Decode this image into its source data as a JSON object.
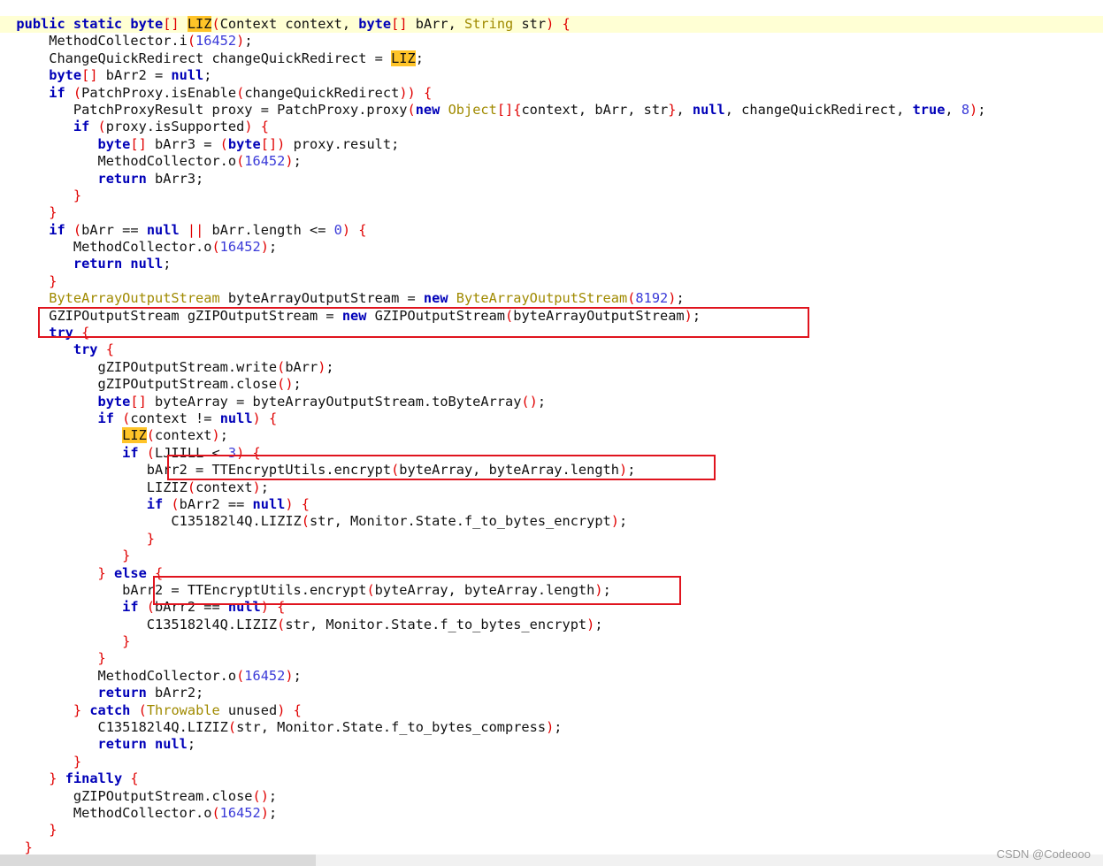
{
  "colors": {
    "plain": "#111111",
    "keyword": "#0000b8",
    "type": "#a08a00",
    "number": "#3a3ad8",
    "bracket": "#e00000",
    "highlight": "#ffc428",
    "annotation_box": "#e0141e"
  },
  "code": {
    "lines": [
      {
        "indent": "  ",
        "hl": true,
        "tokens": [
          [
            "public static ",
            "k"
          ],
          [
            "byte",
            "k"
          ],
          [
            "[]",
            "b"
          ],
          [
            " ",
            "p"
          ],
          [
            "LIZ",
            "h"
          ],
          [
            "(",
            "b"
          ],
          [
            "Context context, ",
            "p"
          ],
          [
            "byte",
            "k"
          ],
          [
            "[]",
            "b"
          ],
          [
            " bArr, ",
            "p"
          ],
          [
            "String",
            "t"
          ],
          [
            " str",
            "p"
          ],
          [
            ")",
            "b"
          ],
          [
            " {",
            "b"
          ]
        ]
      },
      {
        "indent": "      ",
        "tokens": [
          [
            "MethodCollector.i",
            "p"
          ],
          [
            "(",
            "b"
          ],
          [
            "16452",
            "n"
          ],
          [
            ")",
            "b"
          ],
          [
            ";",
            "p"
          ]
        ]
      },
      {
        "indent": "      ",
        "tokens": [
          [
            "ChangeQuickRedirect changeQuickRedirect = ",
            "p"
          ],
          [
            "LIZ",
            "h"
          ],
          [
            ";",
            "p"
          ]
        ]
      },
      {
        "indent": "      ",
        "tokens": [
          [
            "byte",
            "k"
          ],
          [
            "[]",
            "b"
          ],
          [
            " bArr2 = ",
            "p"
          ],
          [
            "null",
            "k"
          ],
          [
            ";",
            "p"
          ]
        ]
      },
      {
        "indent": "      ",
        "tokens": [
          [
            "if",
            "k"
          ],
          [
            " ",
            "p"
          ],
          [
            "(",
            "b"
          ],
          [
            "PatchProxy.isEnable",
            "p"
          ],
          [
            "(",
            "b"
          ],
          [
            "changeQuickRedirect",
            "p"
          ],
          [
            ")",
            "b"
          ],
          [
            ")",
            "b"
          ],
          [
            " {",
            "b"
          ]
        ]
      },
      {
        "indent": "         ",
        "tokens": [
          [
            "PatchProxyResult proxy = PatchProxy.proxy",
            "p"
          ],
          [
            "(",
            "b"
          ],
          [
            "new",
            "k"
          ],
          [
            " ",
            "p"
          ],
          [
            "Object",
            "t"
          ],
          [
            "[]{",
            "b"
          ],
          [
            "context, bArr, str",
            "p"
          ],
          [
            "}",
            "b"
          ],
          [
            ", ",
            "p"
          ],
          [
            "null",
            "k"
          ],
          [
            ", changeQuickRedirect, ",
            "p"
          ],
          [
            "true",
            "k"
          ],
          [
            ", ",
            "p"
          ],
          [
            "8",
            "n"
          ],
          [
            ")",
            "b"
          ],
          [
            ";",
            "p"
          ]
        ]
      },
      {
        "indent": "         ",
        "tokens": [
          [
            "if",
            "k"
          ],
          [
            " ",
            "p"
          ],
          [
            "(",
            "b"
          ],
          [
            "proxy.isSupported",
            "p"
          ],
          [
            ")",
            "b"
          ],
          [
            " {",
            "b"
          ]
        ]
      },
      {
        "indent": "            ",
        "tokens": [
          [
            "byte",
            "k"
          ],
          [
            "[]",
            "b"
          ],
          [
            " bArr3 = ",
            "p"
          ],
          [
            "(",
            "b"
          ],
          [
            "byte",
            "k"
          ],
          [
            "[])",
            "b"
          ],
          [
            " proxy.result;",
            "p"
          ]
        ]
      },
      {
        "indent": "            ",
        "tokens": [
          [
            "MethodCollector.o",
            "p"
          ],
          [
            "(",
            "b"
          ],
          [
            "16452",
            "n"
          ],
          [
            ")",
            "b"
          ],
          [
            ";",
            "p"
          ]
        ]
      },
      {
        "indent": "            ",
        "tokens": [
          [
            "return",
            "k"
          ],
          [
            " bArr3;",
            "p"
          ]
        ]
      },
      {
        "indent": "         ",
        "tokens": [
          [
            "}",
            "b"
          ]
        ]
      },
      {
        "indent": "      ",
        "tokens": [
          [
            "}",
            "b"
          ]
        ]
      },
      {
        "indent": "      ",
        "tokens": [
          [
            "if",
            "k"
          ],
          [
            " ",
            "p"
          ],
          [
            "(",
            "b"
          ],
          [
            "bArr == ",
            "p"
          ],
          [
            "null",
            "k"
          ],
          [
            " ",
            "p"
          ],
          [
            "||",
            "b"
          ],
          [
            " bArr.length <= ",
            "p"
          ],
          [
            "0",
            "n"
          ],
          [
            ")",
            "b"
          ],
          [
            " {",
            "b"
          ]
        ]
      },
      {
        "indent": "         ",
        "tokens": [
          [
            "MethodCollector.o",
            "p"
          ],
          [
            "(",
            "b"
          ],
          [
            "16452",
            "n"
          ],
          [
            ")",
            "b"
          ],
          [
            ";",
            "p"
          ]
        ]
      },
      {
        "indent": "         ",
        "tokens": [
          [
            "return",
            "k"
          ],
          [
            " ",
            "p"
          ],
          [
            "null",
            "k"
          ],
          [
            ";",
            "p"
          ]
        ]
      },
      {
        "indent": "      ",
        "tokens": [
          [
            "}",
            "b"
          ]
        ]
      },
      {
        "indent": "      ",
        "tokens": [
          [
            "ByteArrayOutputStream",
            "t"
          ],
          [
            " byteArrayOutputStream = ",
            "p"
          ],
          [
            "new",
            "k"
          ],
          [
            " ",
            "p"
          ],
          [
            "ByteArrayOutputStream",
            "t"
          ],
          [
            "(",
            "b"
          ],
          [
            "8192",
            "n"
          ],
          [
            ")",
            "b"
          ],
          [
            ";",
            "p"
          ]
        ]
      },
      {
        "indent": "      ",
        "tokens": [
          [
            "GZIPOutputStream gZIPOutputStream = ",
            "p"
          ],
          [
            "new",
            "k"
          ],
          [
            " GZIPOutputStream",
            "p"
          ],
          [
            "(",
            "b"
          ],
          [
            "byteArrayOutputStream",
            "p"
          ],
          [
            ")",
            "b"
          ],
          [
            ";",
            "p"
          ]
        ]
      },
      {
        "indent": "      ",
        "tokens": [
          [
            "try",
            "k"
          ],
          [
            " {",
            "b"
          ]
        ]
      },
      {
        "indent": "         ",
        "tokens": [
          [
            "try",
            "k"
          ],
          [
            " {",
            "b"
          ]
        ]
      },
      {
        "indent": "            ",
        "tokens": [
          [
            "gZIPOutputStream.write",
            "p"
          ],
          [
            "(",
            "b"
          ],
          [
            "bArr",
            "p"
          ],
          [
            ")",
            "b"
          ],
          [
            ";",
            "p"
          ]
        ]
      },
      {
        "indent": "            ",
        "tokens": [
          [
            "gZIPOutputStream.close",
            "p"
          ],
          [
            "()",
            "b"
          ],
          [
            ";",
            "p"
          ]
        ]
      },
      {
        "indent": "            ",
        "tokens": [
          [
            "byte",
            "k"
          ],
          [
            "[]",
            "b"
          ],
          [
            " byteArray = byteArrayOutputStream.toByteArray",
            "p"
          ],
          [
            "()",
            "b"
          ],
          [
            ";",
            "p"
          ]
        ]
      },
      {
        "indent": "            ",
        "tokens": [
          [
            "if",
            "k"
          ],
          [
            " ",
            "p"
          ],
          [
            "(",
            "b"
          ],
          [
            "context != ",
            "p"
          ],
          [
            "null",
            "k"
          ],
          [
            ")",
            "b"
          ],
          [
            " {",
            "b"
          ]
        ]
      },
      {
        "indent": "               ",
        "tokens": [
          [
            "LIZ",
            "h"
          ],
          [
            "(",
            "b"
          ],
          [
            "context",
            "p"
          ],
          [
            ")",
            "b"
          ],
          [
            ";",
            "p"
          ]
        ]
      },
      {
        "indent": "               ",
        "tokens": [
          [
            "if",
            "k"
          ],
          [
            " ",
            "p"
          ],
          [
            "(",
            "b"
          ],
          [
            "LJIILL < ",
            "p"
          ],
          [
            "3",
            "n"
          ],
          [
            ")",
            "b"
          ],
          [
            " {",
            "b"
          ]
        ]
      },
      {
        "indent": "                  ",
        "tokens": [
          [
            "bArr2 = TTEncryptUtils.encrypt",
            "p"
          ],
          [
            "(",
            "b"
          ],
          [
            "byteArray, byteArray.length",
            "p"
          ],
          [
            ")",
            "b"
          ],
          [
            ";",
            "p"
          ]
        ]
      },
      {
        "indent": "                  ",
        "tokens": [
          [
            "LIZIZ",
            "p"
          ],
          [
            "(",
            "b"
          ],
          [
            "context",
            "p"
          ],
          [
            ")",
            "b"
          ],
          [
            ";",
            "p"
          ]
        ]
      },
      {
        "indent": "                  ",
        "tokens": [
          [
            "if",
            "k"
          ],
          [
            " ",
            "p"
          ],
          [
            "(",
            "b"
          ],
          [
            "bArr2 == ",
            "p"
          ],
          [
            "null",
            "k"
          ],
          [
            ")",
            "b"
          ],
          [
            " {",
            "b"
          ]
        ]
      },
      {
        "indent": "                     ",
        "tokens": [
          [
            "C135182l4Q.LIZIZ",
            "p"
          ],
          [
            "(",
            "b"
          ],
          [
            "str, Monitor.State.f_to_bytes_encrypt",
            "p"
          ],
          [
            ")",
            "b"
          ],
          [
            ";",
            "p"
          ]
        ]
      },
      {
        "indent": "                  ",
        "tokens": [
          [
            "}",
            "b"
          ]
        ]
      },
      {
        "indent": "               ",
        "tokens": [
          [
            "}",
            "b"
          ]
        ]
      },
      {
        "indent": "            ",
        "tokens": [
          [
            "}",
            "b"
          ],
          [
            " ",
            "p"
          ],
          [
            "else",
            "k"
          ],
          [
            " {",
            "b"
          ]
        ]
      },
      {
        "indent": "               ",
        "tokens": [
          [
            "bArr2 = TTEncryptUtils.encrypt",
            "p"
          ],
          [
            "(",
            "b"
          ],
          [
            "byteArray, byteArray.length",
            "p"
          ],
          [
            ")",
            "b"
          ],
          [
            ";",
            "p"
          ]
        ]
      },
      {
        "indent": "               ",
        "tokens": [
          [
            "if",
            "k"
          ],
          [
            " ",
            "p"
          ],
          [
            "(",
            "b"
          ],
          [
            "bArr2 == ",
            "p"
          ],
          [
            "null",
            "k"
          ],
          [
            ")",
            "b"
          ],
          [
            " {",
            "b"
          ]
        ]
      },
      {
        "indent": "                  ",
        "tokens": [
          [
            "C135182l4Q.LIZIZ",
            "p"
          ],
          [
            "(",
            "b"
          ],
          [
            "str, Monitor.State.f_to_bytes_encrypt",
            "p"
          ],
          [
            ")",
            "b"
          ],
          [
            ";",
            "p"
          ]
        ]
      },
      {
        "indent": "               ",
        "tokens": [
          [
            "}",
            "b"
          ]
        ]
      },
      {
        "indent": "            ",
        "tokens": [
          [
            "}",
            "b"
          ]
        ]
      },
      {
        "indent": "            ",
        "tokens": [
          [
            "MethodCollector.o",
            "p"
          ],
          [
            "(",
            "b"
          ],
          [
            "16452",
            "n"
          ],
          [
            ")",
            "b"
          ],
          [
            ";",
            "p"
          ]
        ]
      },
      {
        "indent": "            ",
        "tokens": [
          [
            "return",
            "k"
          ],
          [
            " bArr2;",
            "p"
          ]
        ]
      },
      {
        "indent": "         ",
        "tokens": [
          [
            "}",
            "b"
          ],
          [
            " ",
            "p"
          ],
          [
            "catch",
            "k"
          ],
          [
            " ",
            "p"
          ],
          [
            "(",
            "b"
          ],
          [
            "Throwable",
            "t"
          ],
          [
            " unused",
            "p"
          ],
          [
            ")",
            "b"
          ],
          [
            " {",
            "b"
          ]
        ]
      },
      {
        "indent": "            ",
        "tokens": [
          [
            "C135182l4Q.LIZIZ",
            "p"
          ],
          [
            "(",
            "b"
          ],
          [
            "str, Monitor.State.f_to_bytes_compress",
            "p"
          ],
          [
            ")",
            "b"
          ],
          [
            ";",
            "p"
          ]
        ]
      },
      {
        "indent": "            ",
        "tokens": [
          [
            "return",
            "k"
          ],
          [
            " ",
            "p"
          ],
          [
            "null",
            "k"
          ],
          [
            ";",
            "p"
          ]
        ]
      },
      {
        "indent": "         ",
        "tokens": [
          [
            "}",
            "b"
          ]
        ]
      },
      {
        "indent": "      ",
        "tokens": [
          [
            "}",
            "b"
          ],
          [
            " ",
            "p"
          ],
          [
            "finally",
            "k"
          ],
          [
            " {",
            "b"
          ]
        ]
      },
      {
        "indent": "         ",
        "tokens": [
          [
            "gZIPOutputStream.close",
            "p"
          ],
          [
            "()",
            "b"
          ],
          [
            ";",
            "p"
          ]
        ]
      },
      {
        "indent": "         ",
        "tokens": [
          [
            "MethodCollector.o",
            "p"
          ],
          [
            "(",
            "b"
          ],
          [
            "16452",
            "n"
          ],
          [
            ")",
            "b"
          ],
          [
            ";",
            "p"
          ]
        ]
      },
      {
        "indent": "      ",
        "tokens": [
          [
            "}",
            "b"
          ]
        ]
      },
      {
        "indent": "   ",
        "tokens": [
          [
            "}",
            "b"
          ]
        ]
      }
    ]
  },
  "watermark": "CSDN @Codeooo"
}
